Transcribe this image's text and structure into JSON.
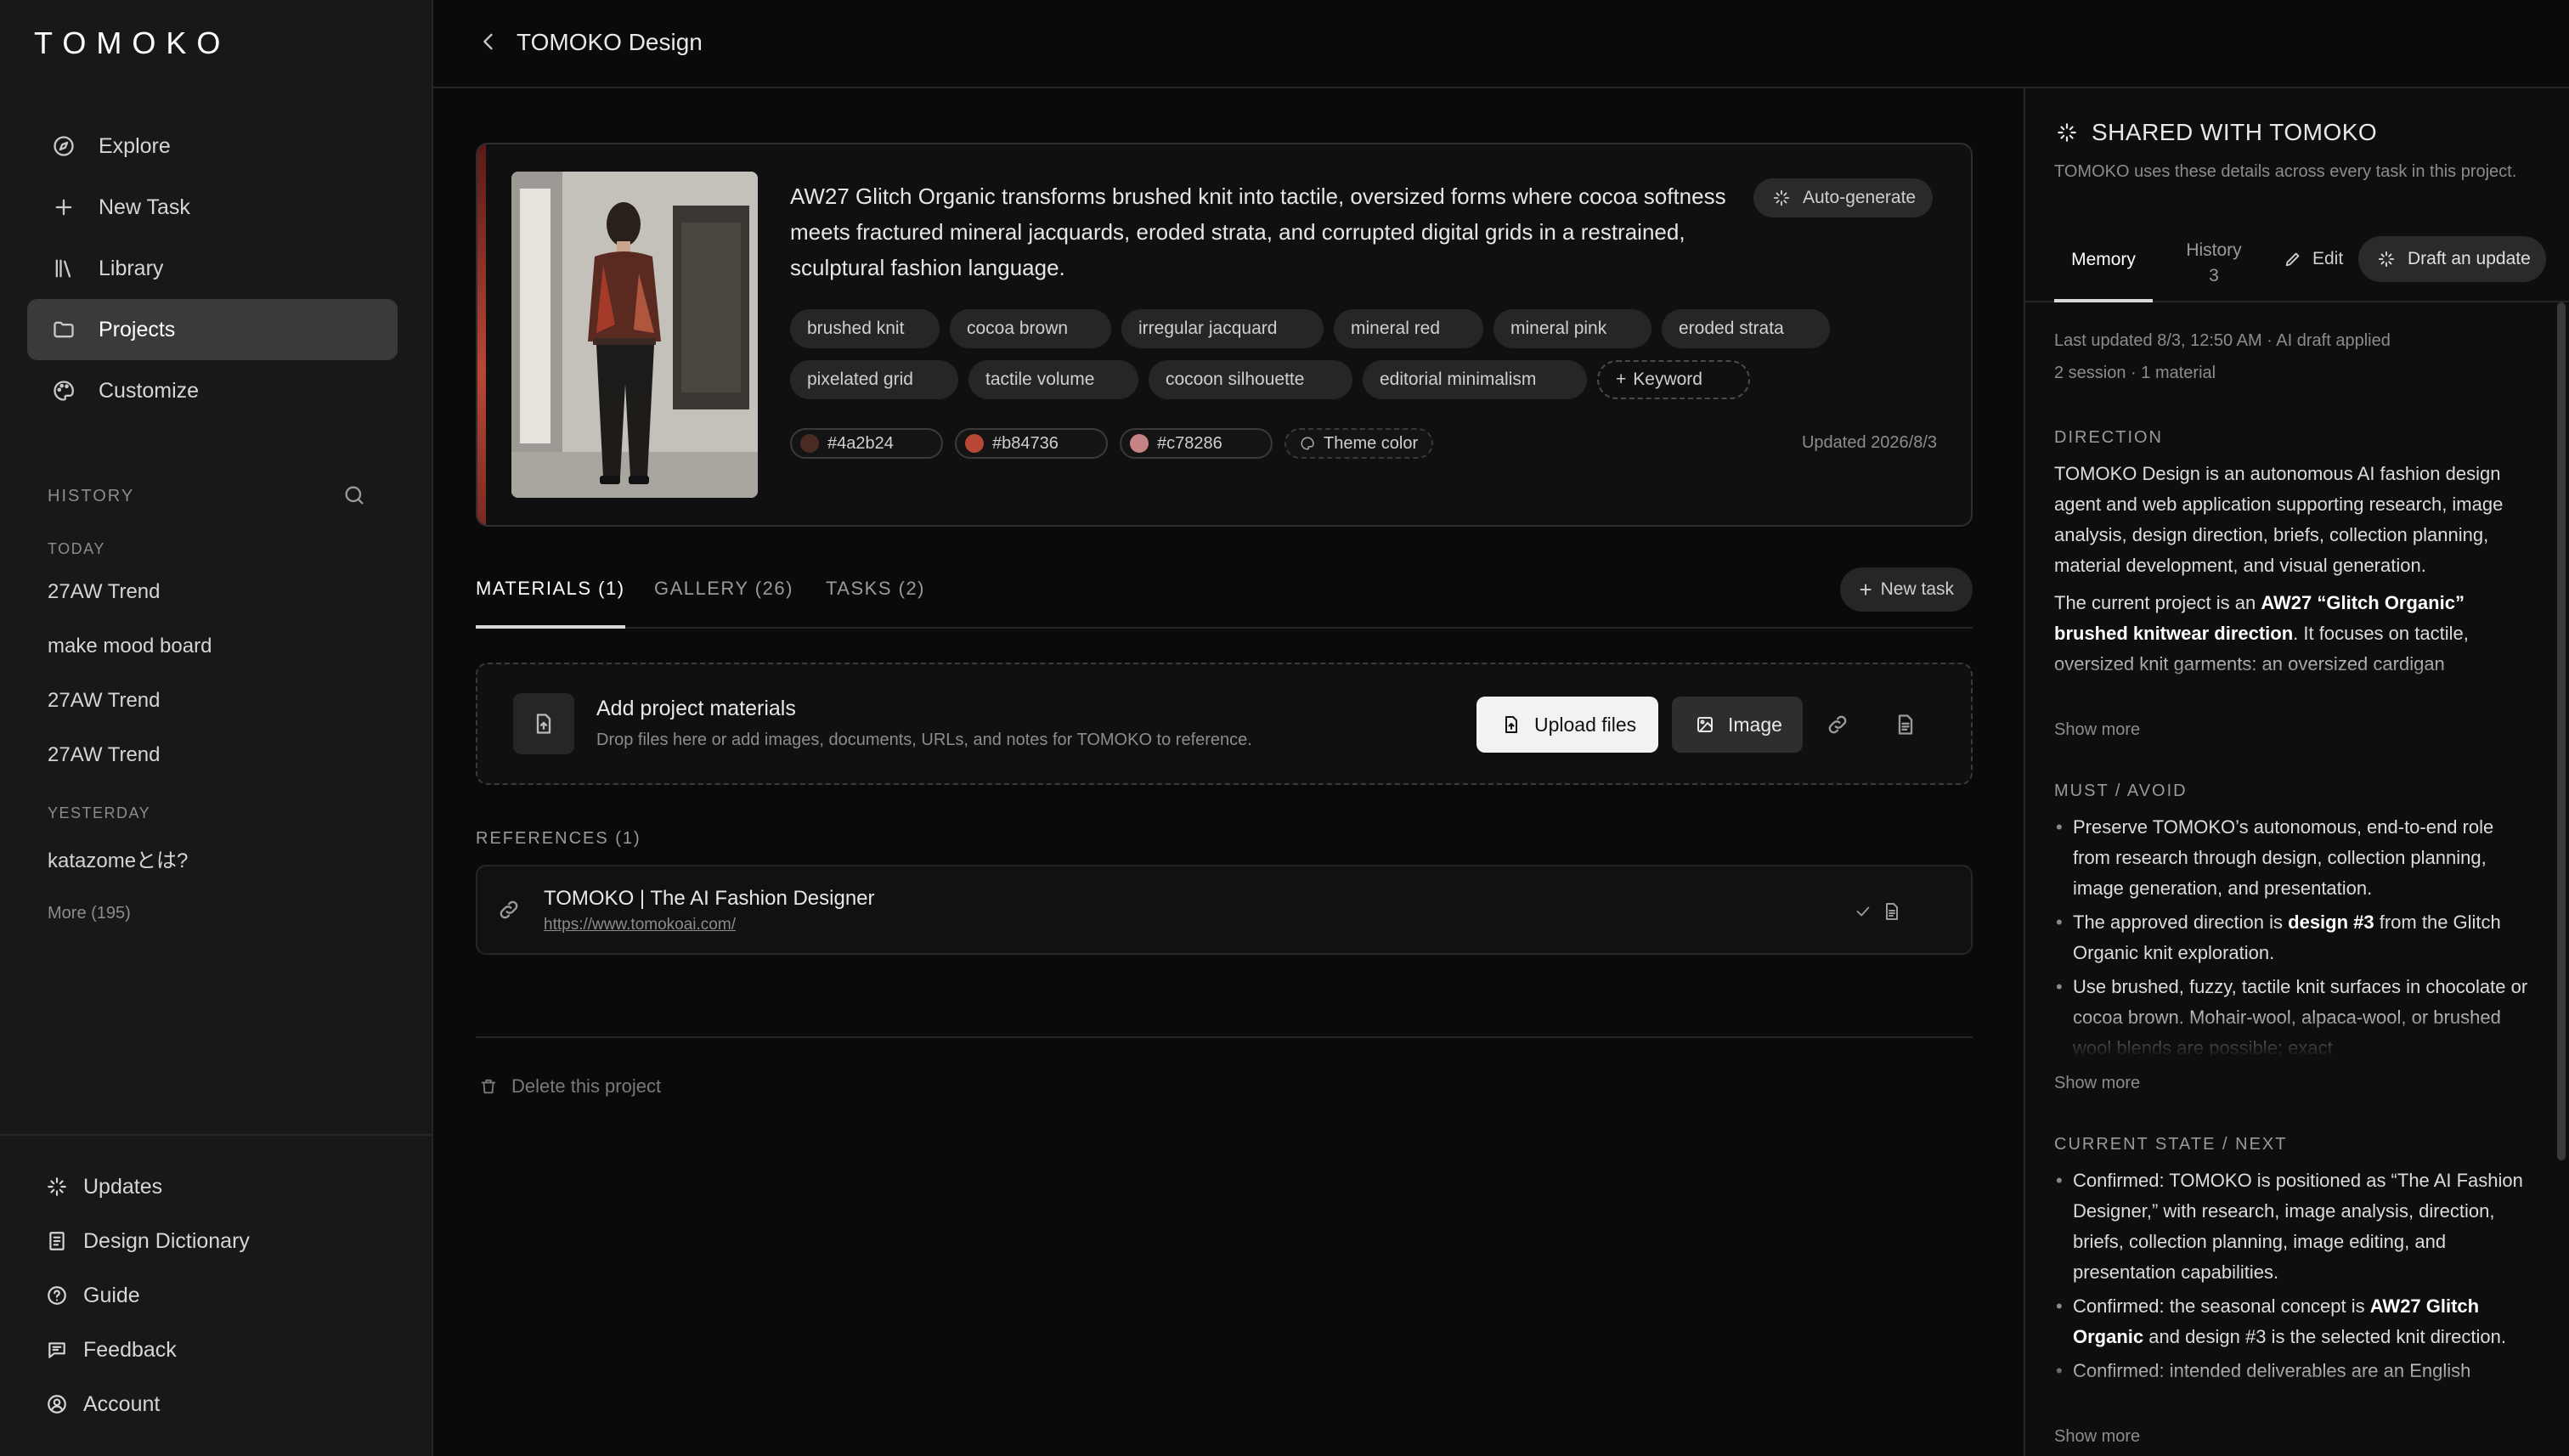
{
  "app": {
    "logo": "TOMOKO"
  },
  "sidebar": {
    "nav": [
      {
        "label": "Explore",
        "icon": "compass-icon"
      },
      {
        "label": "New Task",
        "icon": "plus-icon"
      },
      {
        "label": "Library",
        "icon": "library-icon"
      },
      {
        "label": "Projects",
        "icon": "folder-icon",
        "active": true
      },
      {
        "label": "Customize",
        "icon": "palette-icon"
      }
    ],
    "history_heading": "HISTORY",
    "today_label": "TODAY",
    "today": [
      "27AW Trend",
      "make mood board",
      "27AW Trend",
      "27AW Trend"
    ],
    "yesterday_label": "YESTERDAY",
    "yesterday": [
      "katazomeとは?"
    ],
    "more": "More (195)",
    "footer": [
      {
        "label": "Updates",
        "icon": "sparkle-icon"
      },
      {
        "label": "Design Dictionary",
        "icon": "book-icon"
      },
      {
        "label": "Guide",
        "icon": "help-circle-icon"
      },
      {
        "label": "Feedback",
        "icon": "message-icon"
      },
      {
        "label": "Account",
        "icon": "user-circle-icon"
      }
    ]
  },
  "header": {
    "title": "TOMOKO Design"
  },
  "project": {
    "description": "AW27 Glitch Organic transforms brushed knit into tactile, oversized forms where cocoa softness meets fractured mineral jacquards, eroded strata, and corrupted digital grids in a restrained, sculptural fashion language.",
    "autogen_label": "Auto-generate",
    "tags_row1": [
      "brushed knit",
      "cocoa brown",
      "irregular jacquard",
      "mineral red",
      "mineral pink",
      "eroded strata"
    ],
    "tags_row2": [
      "pixelated grid",
      "tactile volume",
      "cocoon silhouette",
      "editorial minimalism"
    ],
    "add_keyword": "Keyword",
    "colors": [
      {
        "hex": "#4a2b24"
      },
      {
        "hex": "#b84736"
      },
      {
        "hex": "#c78286"
      }
    ],
    "theme_color_label": "Theme color",
    "updated": "Updated 2026/8/3"
  },
  "tabs": {
    "materials": "MATERIALS (1)",
    "gallery": "GALLERY (26)",
    "tasks": "TASKS (2)",
    "new_task": "New task"
  },
  "drop": {
    "title": "Add project materials",
    "subtitle": "Drop files here or add images, documents, URLs, and notes for TOMOKO to reference.",
    "upload": "Upload files",
    "image": "Image"
  },
  "references": {
    "heading": "REFERENCES (1)",
    "items": [
      {
        "title": "TOMOKO | The AI Fashion Designer",
        "url": "https://www.tomokoai.com/"
      }
    ]
  },
  "delete_label": "Delete this project",
  "panel": {
    "title": "SHARED WITH TOMOKO",
    "subtitle": "TOMOKO uses these details across every task in this project.",
    "tab_memory": "Memory",
    "tab_history": "History",
    "tab_history_count": "3",
    "edit": "Edit",
    "draft": "Draft an update",
    "last_updated": "Last updated 8/3, 12:50 AM · AI draft applied",
    "stats": "2 session · 1 material",
    "direction_h": "DIRECTION",
    "direction_p1": "TOMOKO Design is an autonomous AI fashion design agent and web application supporting research, image analysis, design direction, briefs, collection planning, material development, and visual generation.",
    "direction_p2_a": "The current project is an ",
    "direction_p2_b": "AW27 “Glitch Organic” brushed knitwear direction",
    "direction_p2_c": ". It focuses on tactile, oversized knit garments: an oversized cardigan",
    "must_h": "MUST / AVOID",
    "must_1": "Preserve TOMOKO’s autonomous, end-to-end role from research through design, collection planning, image generation, and presentation.",
    "must_2_a": "The approved direction is ",
    "must_2_b": "design #3",
    "must_2_c": " from the Glitch Organic knit exploration.",
    "must_3": "Use brushed, fuzzy, tactile knit surfaces in chocolate or cocoa brown. Mohair-wool, alpaca-wool, or brushed wool blends are possible; exact",
    "state_h": "CURRENT STATE / NEXT",
    "state_1": "Confirmed: TOMOKO is positioned as “The AI Fashion Designer,” with research, image analysis, direction, briefs, collection planning, image editing, and presentation capabilities.",
    "state_2_a": "Confirmed: the seasonal concept is ",
    "state_2_b": "AW27 Glitch Organic",
    "state_2_c": " and design #3 is the selected knit direction.",
    "state_3": "Confirmed: intended deliverables are an English",
    "show_more": "Show more"
  }
}
